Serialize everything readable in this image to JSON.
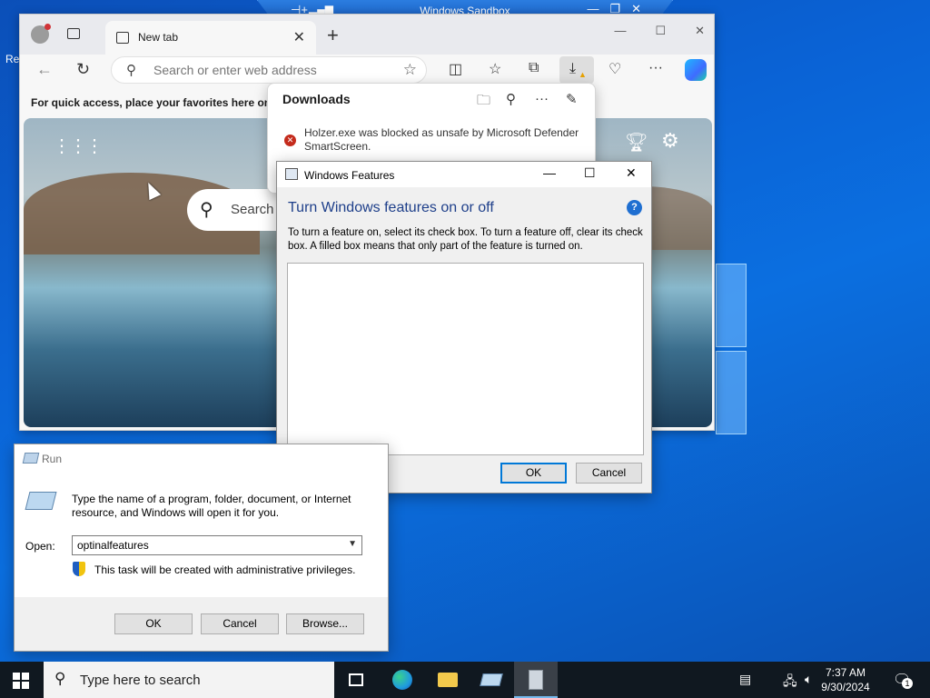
{
  "sandbox": {
    "title": "Windows Sandbox"
  },
  "desktop": {
    "recycle_stub": "Re"
  },
  "browser": {
    "tab_label": "New tab",
    "address_placeholder": "Search or enter web address",
    "favorites_hint": "For quick access, place your favorites here on the",
    "ntp_search_label": "Search"
  },
  "downloads": {
    "title": "Downloads",
    "blocked_message": "Holzer.exe was blocked as unsafe by Microsoft Defender SmartScreen."
  },
  "features_dialog": {
    "title": "Windows Features",
    "heading": "Turn Windows features on or off",
    "description": "To turn a feature on, select its check box. To turn a feature off, clear its check box. A filled box means that only part of the feature is turned on.",
    "ok_label": "OK",
    "cancel_label": "Cancel",
    "help_glyph": "?"
  },
  "run_dialog": {
    "title": "Run",
    "instructions": "Type the name of a program, folder, document, or Internet resource, and Windows will open it for you.",
    "open_label": "Open:",
    "open_value": "optinalfeatures",
    "admin_note": "This task will be created with administrative privileges.",
    "ok_label": "OK",
    "cancel_label": "Cancel",
    "browse_label": "Browse..."
  },
  "taskbar": {
    "search_placeholder": "Type here to search",
    "time": "7:37 AM",
    "date": "9/30/2024",
    "notification_count": "1"
  },
  "icons": {
    "edge_color": "#1f9bde",
    "explorer_color": "#f2c94c",
    "error_color": "#c42b1c"
  }
}
